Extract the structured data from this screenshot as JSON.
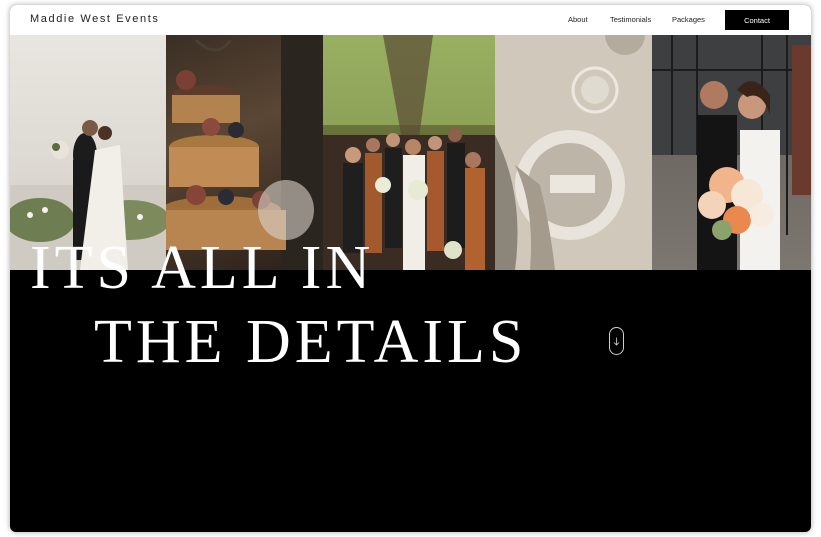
{
  "header": {
    "brand": "Maddie West Events",
    "nav": [
      "About",
      "Testimonials",
      "Packages"
    ],
    "contact_label": "Contact"
  },
  "hero": {
    "headline_line1": "ITS ALL IN",
    "headline_line2": "THE DETAILS",
    "scroll_icon": "arrow-down-icon"
  },
  "photos": [
    "bride-groom-kiss-photo",
    "wedding-cake-photo",
    "bridal-party-photo",
    "table-setting-photo",
    "couple-bouquet-photo"
  ],
  "colors": {
    "background": "#000000",
    "header_bg": "#ffffff",
    "contact_bg": "#000000",
    "headline": "#ffffff"
  }
}
